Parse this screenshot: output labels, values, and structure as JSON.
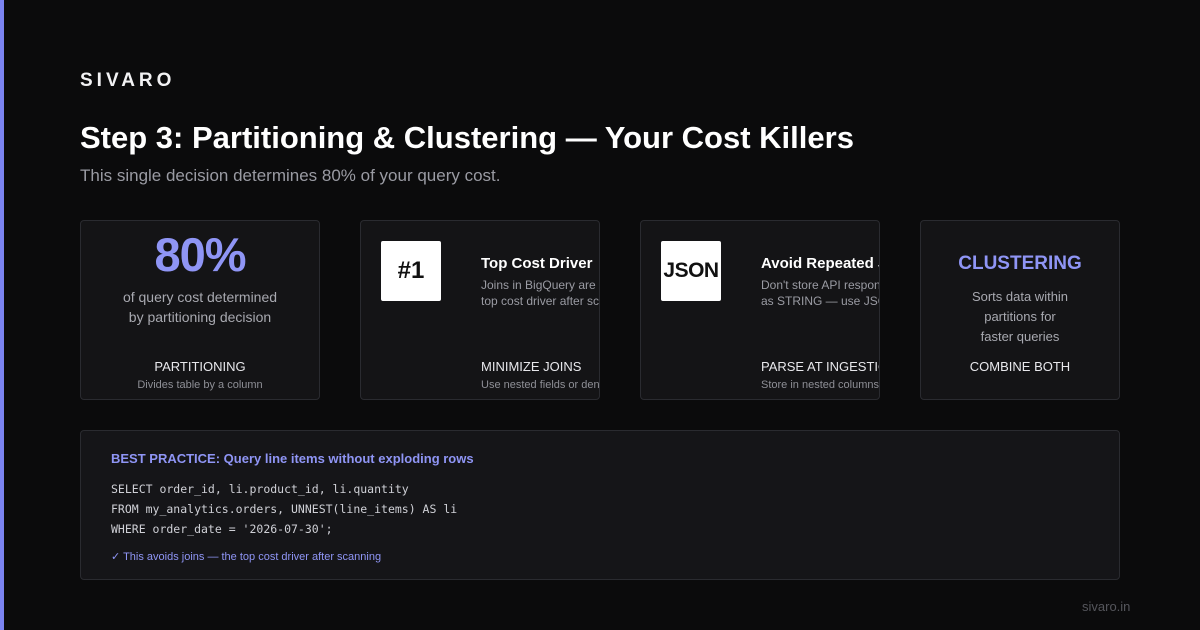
{
  "brand": "SIVARO",
  "title": "Step 3: Partitioning & Clustering — Your Cost Killers",
  "subtitle": "This single decision determines 80% of your query cost.",
  "cards": {
    "stat": {
      "value": "80%",
      "desc_line1": "of query cost determined",
      "desc_line2": "by partitioning decision",
      "label": "PARTITIONING",
      "sublabel": "Divides table by a column"
    },
    "joins": {
      "icon_text": "#1",
      "heading": "Top Cost Driver",
      "body_line1": "Joins in BigQuery are the",
      "body_line2": "top cost driver after scanning",
      "label": "MINIMIZE JOINS",
      "sublabel": "Use nested fields or denormalize"
    },
    "json": {
      "icon_text": "JSON",
      "heading": "Avoid Repeated JSON",
      "body_line1": "Don't store API responses",
      "body_line2": "as STRING — use JSON type",
      "label": "PARSE AT INGESTION",
      "sublabel": "Store in nested columns"
    },
    "clustering": {
      "heading": "CLUSTERING",
      "desc_line1": "Sorts data within",
      "desc_line2": "partitions for",
      "desc_line3": "faster queries",
      "label": "COMBINE BOTH"
    }
  },
  "code_panel": {
    "title": "BEST PRACTICE: Query line items without exploding rows",
    "lines": [
      "SELECT order_id, li.product_id, li.quantity",
      "FROM my_analytics.orders, UNNEST(line_items) AS li",
      "WHERE order_date = '2026-07-30';"
    ],
    "note": "✓ This avoids joins — the top cost driver after scanning"
  },
  "footer_url": "sivaro.in",
  "colors": {
    "accent": "#8f95f5",
    "background": "#0b0b0c",
    "card_background": "#141416"
  }
}
